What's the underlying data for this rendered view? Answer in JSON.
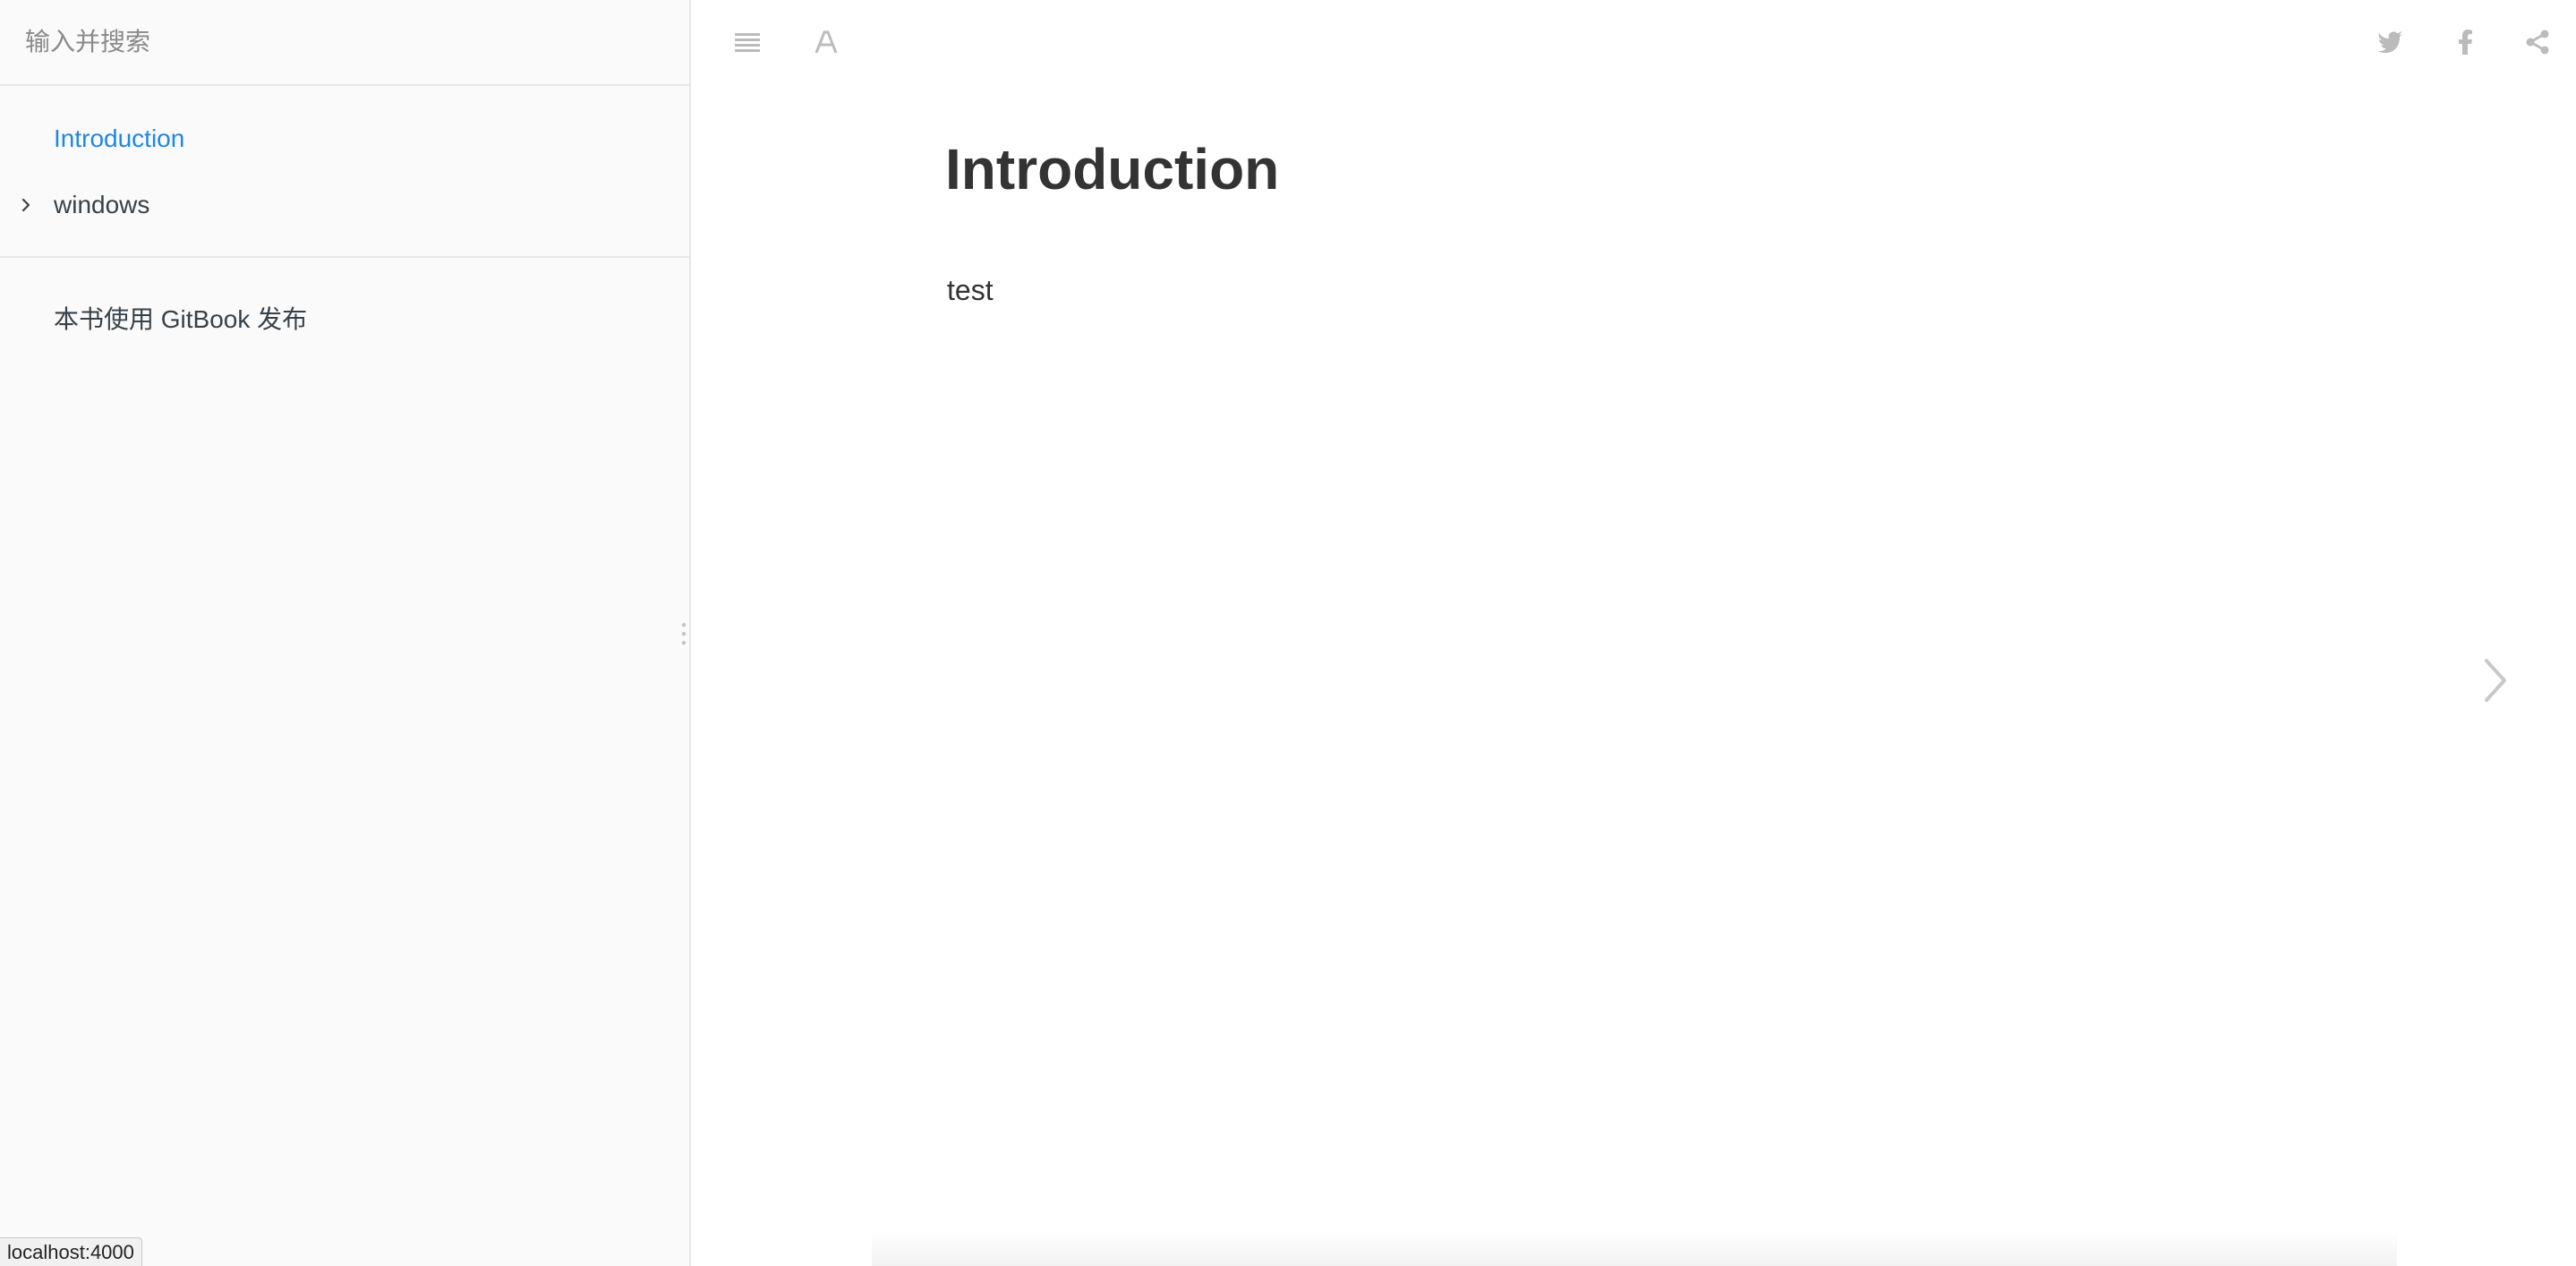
{
  "search": {
    "placeholder": "输入并搜索"
  },
  "summary": {
    "items": [
      {
        "label": "Introduction",
        "active": true
      },
      {
        "label": "windows",
        "expandable": true
      }
    ],
    "footer_link": "本书使用 GitBook 发布"
  },
  "toolbar": {
    "left_icons": [
      "menu-icon",
      "font-settings-icon"
    ],
    "right_icons": [
      "twitter-icon",
      "facebook-icon",
      "share-icon"
    ]
  },
  "page": {
    "title": "Introduction",
    "body": "test"
  },
  "status_bar": {
    "url": "localhost:4000"
  },
  "colors": {
    "accent": "#1e88e5",
    "sidebar_bg": "#fafafa",
    "icon_gray": "#bbbbbb",
    "text": "#333333"
  }
}
